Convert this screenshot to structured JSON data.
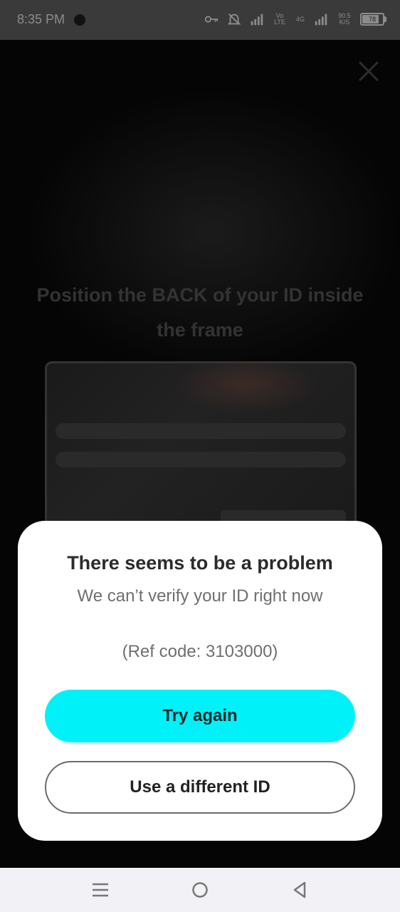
{
  "status_bar": {
    "time": "8:35 PM",
    "net_1": "Vo LTE",
    "net_2": "4G",
    "speed": "90.5 K/S",
    "battery": "78"
  },
  "screen": {
    "instruction": "Position the BACK of your ID inside the frame"
  },
  "dialog": {
    "title": "There seems to be a problem",
    "subtitle": "We can’t verify your ID right now",
    "ref_code": "(Ref code: 3103000)",
    "primary_button": "Try again",
    "secondary_button": "Use a different ID"
  },
  "colors": {
    "accent": "#00f2f9",
    "sheet_bg": "#ffffff",
    "overlay": "#000000"
  },
  "icons": {
    "close": "close-icon",
    "menu": "menu-icon",
    "home": "home-icon",
    "back": "back-icon"
  },
  "battery_level": 0.78
}
